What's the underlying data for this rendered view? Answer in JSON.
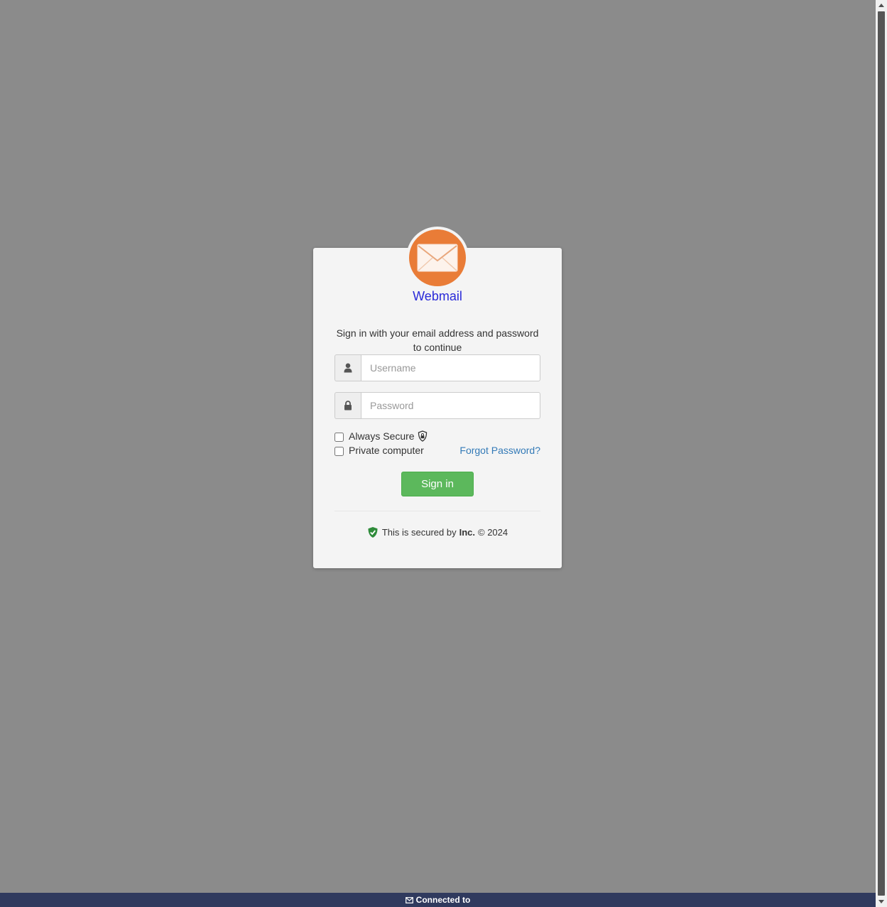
{
  "brand": {
    "name": "Webmail",
    "logo_icon": "envelope-icon",
    "accent": "#e97c37",
    "name_color": "#2a2ad8"
  },
  "login": {
    "intro": "Sign in with your email address and password to continue",
    "username_placeholder": "Username",
    "username_icon": "user-icon",
    "password_placeholder": "Password",
    "password_icon": "lock-icon",
    "always_secure_label": "Always Secure",
    "always_secure_icon": "shield-lock-icon",
    "always_secure_checked": false,
    "private_computer_label": "Private computer",
    "private_computer_checked": false,
    "forgot_password_label": "Forgot Password?",
    "sign_in_label": "Sign in",
    "sign_in_color": "#5cb85c"
  },
  "footer": {
    "secured_prefix": "This is secured by",
    "company": "Inc.",
    "copyright": "© 2024",
    "shield_icon": "shield-check-icon"
  },
  "status_bar": {
    "text": "Connected to",
    "icon": "mail-icon"
  }
}
